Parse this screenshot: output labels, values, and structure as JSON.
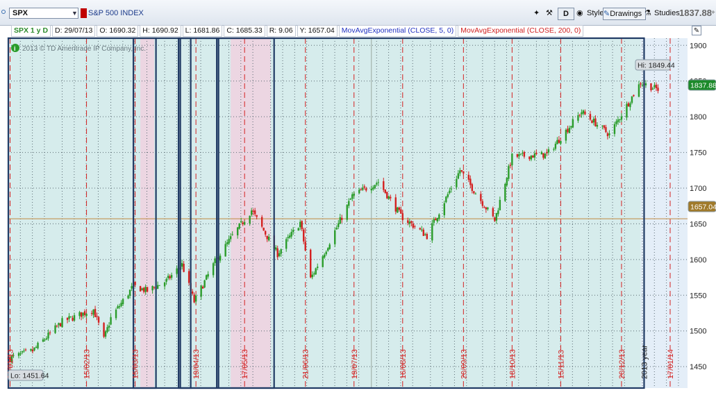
{
  "toolbar": {
    "symbol": "SPX",
    "symbol_name": "S&P 500 INDEX",
    "d_label": "D",
    "style_label": "Style",
    "drawings_label": "Drawings",
    "studies_label": "Studies",
    "last_price": "1837.88"
  },
  "info_bar": {
    "title": "SPX 1 y D",
    "date": "D: 29/07/13",
    "open": "O: 1690.32",
    "high": "H: 1690.92",
    "low": "L: 1681.86",
    "close": "C: 1685.33",
    "range": "R: 9.06",
    "y": "Y: 1657.04",
    "study1": "MovAvgExponential (CLOSE, 5, 0)",
    "study2": "MovAvgExponential (CLOSE, 200, 0)"
  },
  "chart": {
    "copyright": "2013 © TD Ameritrade IP Company, Inc.",
    "hi_label": "Hi: 1849.44",
    "lo_label": "Lo: 1451.64",
    "current_price": "1837.88",
    "cursor_price": "1657.04",
    "year_label": "2013 year",
    "colors": {
      "up": "#2a9c2a",
      "down": "#d42020",
      "background": "#d6ecec",
      "pink_band": "#ecd6e2",
      "box": "#203a64"
    }
  },
  "chart_data": {
    "type": "candlestick",
    "title": "SPX 1 y D",
    "ylim": [
      1420,
      1910
    ],
    "y_ticks": [
      1450,
      1500,
      1550,
      1600,
      1650,
      1700,
      1750,
      1800,
      1850,
      1900
    ],
    "y_tick_labels": [
      "1450",
      "1500",
      "1550",
      "1600",
      "1650",
      "1700",
      "1750",
      "1800",
      "1850",
      "1900"
    ],
    "date_labels": [
      "01/01/13",
      "15/02/13",
      "15/03/13",
      "19/04/13",
      "17/05/13",
      "21/06/13",
      "19/07/13",
      "16/08/13",
      "20/09/13",
      "18/10/13",
      "15/11/13",
      "20/12/13",
      "17/01/14"
    ],
    "close_path": [
      [
        "2013-01-02",
        1462
      ],
      [
        "2013-01-15",
        1472
      ],
      [
        "2013-02-01",
        1513
      ],
      [
        "2013-02-19",
        1530
      ],
      [
        "2013-02-25",
        1488
      ],
      [
        "2013-03-01",
        1518
      ],
      [
        "2013-03-14",
        1563
      ],
      [
        "2013-03-22",
        1556
      ],
      [
        "2013-04-02",
        1570
      ],
      [
        "2013-04-11",
        1593
      ],
      [
        "2013-04-18",
        1541
      ],
      [
        "2013-04-30",
        1597
      ],
      [
        "2013-05-10",
        1633
      ],
      [
        "2013-05-21",
        1669
      ],
      [
        "2013-06-05",
        1608
      ],
      [
        "2013-06-18",
        1652
      ],
      [
        "2013-06-24",
        1573
      ],
      [
        "2013-07-03",
        1615
      ],
      [
        "2013-07-18",
        1689
      ],
      [
        "2013-08-02",
        1709
      ],
      [
        "2013-08-15",
        1661
      ],
      [
        "2013-08-30",
        1633
      ],
      [
        "2013-09-18",
        1725
      ],
      [
        "2013-10-08",
        1655
      ],
      [
        "2013-10-18",
        1744
      ],
      [
        "2013-11-07",
        1747
      ],
      [
        "2013-11-27",
        1807
      ],
      [
        "2013-12-13",
        1775
      ],
      [
        "2013-12-31",
        1848
      ],
      [
        "2014-01-10",
        1838
      ]
    ]
  }
}
